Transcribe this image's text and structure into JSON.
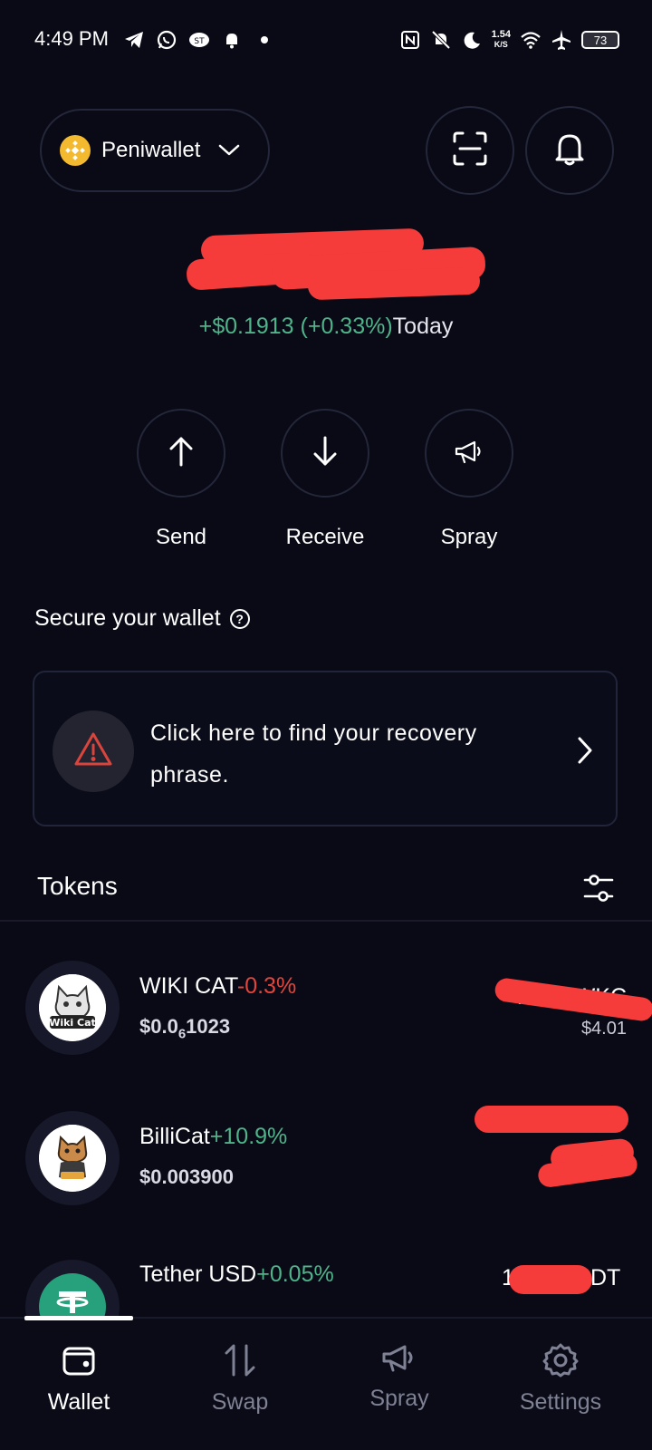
{
  "status_bar": {
    "time": "4:49 PM",
    "speed_value": "1.54",
    "speed_unit": "K/S",
    "battery": "73",
    "left_icons": [
      "telegram-icon",
      "whatsapp-icon",
      "app-icon",
      "notification-icon",
      "dot-icon"
    ],
    "right_icons": [
      "nfc-icon",
      "mute-icon",
      "moon-icon",
      "wifi-icon",
      "airplane-icon"
    ]
  },
  "header": {
    "wallet_name": "Peniwallet",
    "wallet_icon": "bnb-icon",
    "scan_icon": "scan-icon",
    "bell_icon": "bell-icon"
  },
  "balance": {
    "change": "+$0.1913 (+0.33%)",
    "period": "Today"
  },
  "actions": [
    {
      "label": "Send",
      "icon": "arrow-up-icon"
    },
    {
      "label": "Receive",
      "icon": "arrow-down-icon"
    },
    {
      "label": "Spray",
      "icon": "megaphone-icon"
    }
  ],
  "secure": {
    "title": "Secure your wallet",
    "help": "?",
    "card_text": "Click here to find your recovery phrase."
  },
  "tokens": {
    "title": "Tokens",
    "items": [
      {
        "name": "WIKI CAT",
        "change": "-0.3%",
        "direction": "down",
        "price_prefix": "$0.0",
        "price_sub": "6",
        "price_suffix": "1023",
        "amount": "4 .0M WKC",
        "value": "$4.01"
      },
      {
        "name": "BilliCat",
        "change": "+10.9%",
        "direction": "up",
        "price": "$0.003900"
      },
      {
        "name": "Tether USD",
        "change": "+0.05%",
        "direction": "up",
        "amount_prefix": "1",
        "amount_suffix": "DT"
      }
    ]
  },
  "nav": {
    "items": [
      {
        "label": "Wallet",
        "icon": "wallet-icon",
        "active": true
      },
      {
        "label": "Swap",
        "icon": "swap-icon",
        "active": false
      },
      {
        "label": "Spray",
        "icon": "megaphone-icon",
        "active": false
      },
      {
        "label": "Settings",
        "icon": "gear-icon",
        "active": false
      }
    ]
  },
  "colors": {
    "background": "#090a16",
    "positive": "#4fb48a",
    "negative": "#e2453c",
    "redaction": "#f63b3b"
  }
}
